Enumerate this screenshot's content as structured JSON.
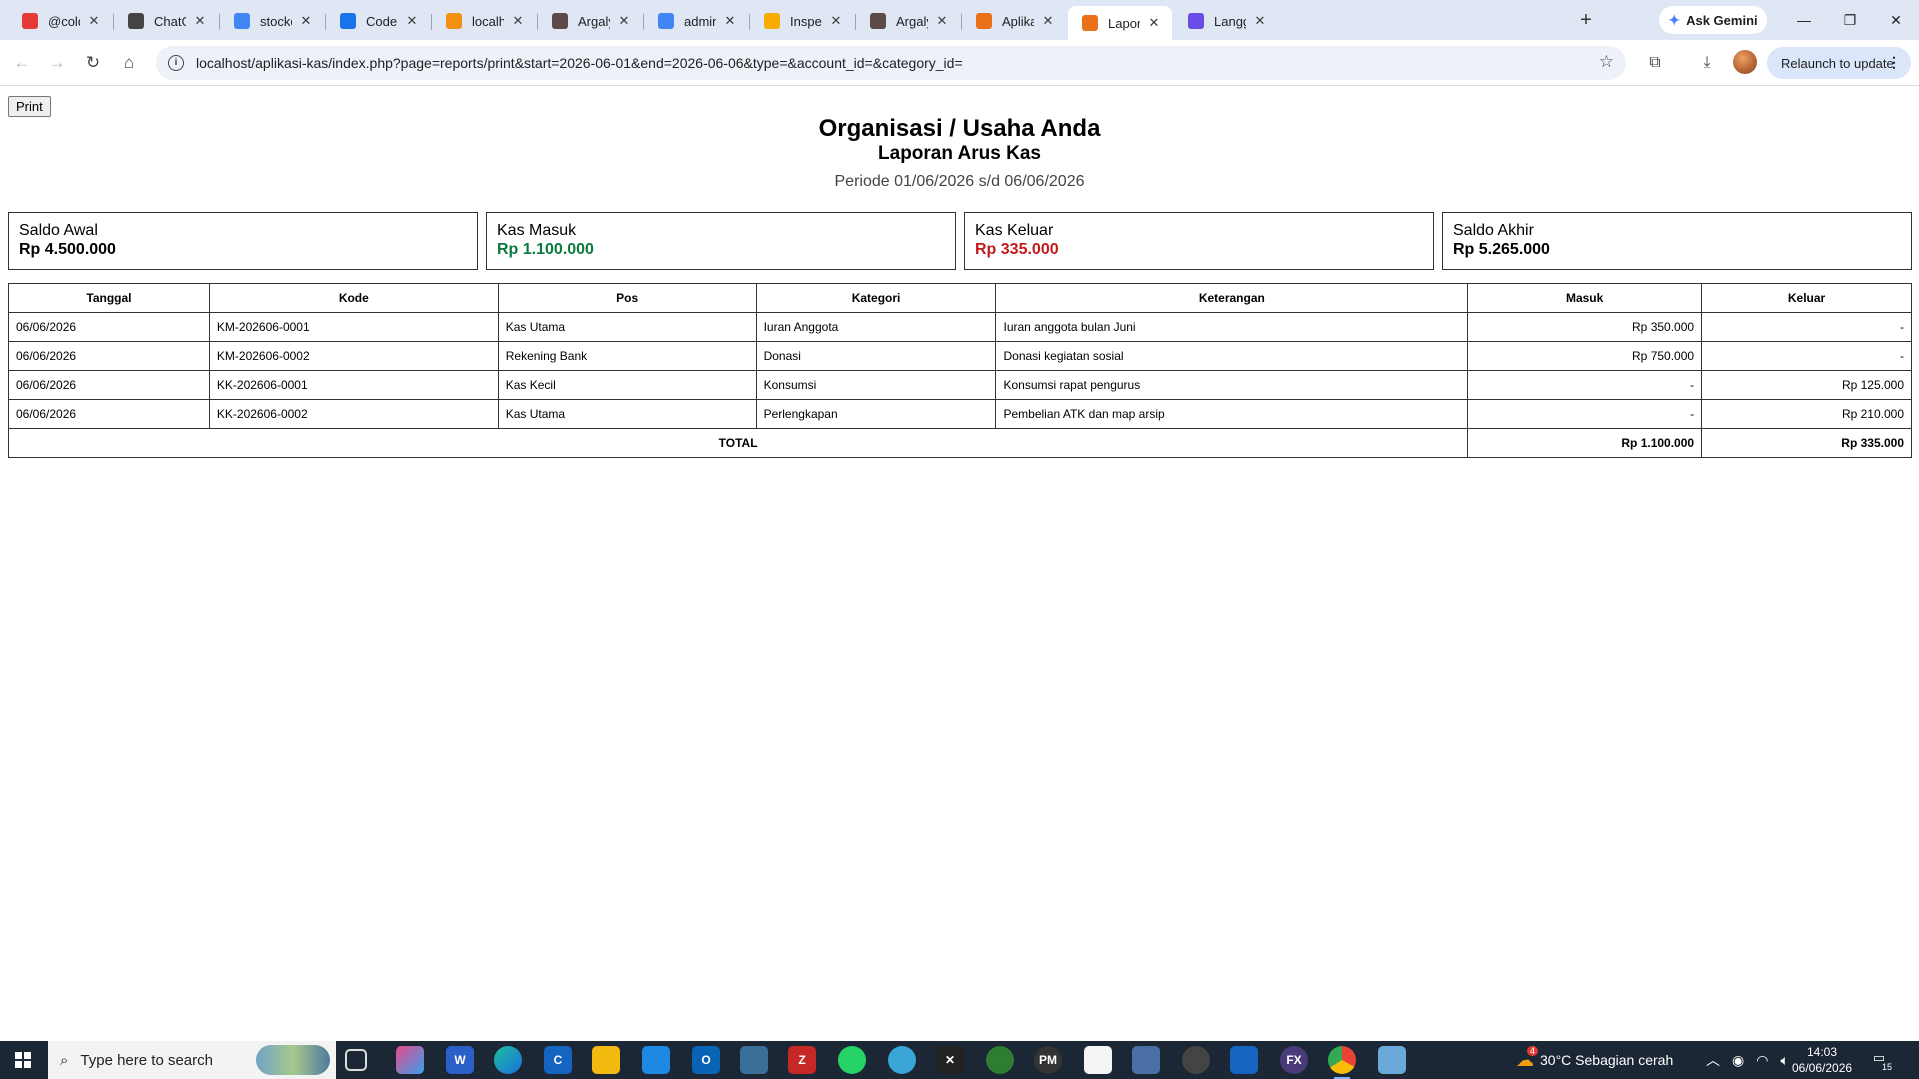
{
  "browser": {
    "tabs": [
      {
        "title": "@coldplay",
        "icon": "youtube-icon",
        "color": "#e53935"
      },
      {
        "title": "ChatGPT -",
        "icon": "chatgpt-icon",
        "color": "#444444"
      },
      {
        "title": "stockcodin",
        "icon": "google-icon",
        "color": "#4285f4"
      },
      {
        "title": "Codeignite",
        "icon": "code-icon",
        "color": "#1a73e8"
      },
      {
        "title": "localhost /",
        "icon": "phpmyadmin-icon",
        "color": "#f29111"
      },
      {
        "title": "Argalyta IT",
        "icon": "site-icon",
        "color": "#5b4a46"
      },
      {
        "title": "admin pan",
        "icon": "google-icon",
        "color": "#4285f4"
      },
      {
        "title": "Inspeksi U",
        "icon": "analytics-icon",
        "color": "#f9ab00"
      },
      {
        "title": "Argalyta IT",
        "icon": "site-icon",
        "color": "#5b4a46"
      },
      {
        "title": "Aplikasi Ka",
        "icon": "app-icon",
        "color": "#e8711a"
      },
      {
        "title": "Laporan Ka",
        "icon": "app-icon",
        "color": "#e8711a"
      },
      {
        "title": "Langganan",
        "icon": "lang-icon",
        "color": "#6b4de6"
      }
    ],
    "active_tab": 10,
    "ask_gemini": "Ask Gemini",
    "url": "localhost/aplikasi-kas/index.php?page=reports/print&start=2026-06-01&end=2026-06-06&type=&account_id=&category_id=",
    "relaunch": "Relaunch to update"
  },
  "page": {
    "print_label": "Print",
    "org_name": "Organisasi / Usaha Anda",
    "report_title": "Laporan Arus Kas",
    "period": "Periode 01/06/2026 s/d 06/06/2026"
  },
  "summary": {
    "saldo_awal": {
      "label": "Saldo Awal",
      "value": "Rp 4.500.000"
    },
    "kas_masuk": {
      "label": "Kas Masuk",
      "value": "Rp 1.100.000"
    },
    "kas_keluar": {
      "label": "Kas Keluar",
      "value": "Rp 335.000"
    },
    "saldo_akhir": {
      "label": "Saldo Akhir",
      "value": "Rp 5.265.000"
    }
  },
  "colors": {
    "in": "#0a7a3e",
    "out": "#c21b1b"
  },
  "table": {
    "headers": [
      "Tanggal",
      "Kode",
      "Pos",
      "Kategori",
      "Keterangan",
      "Masuk",
      "Keluar"
    ],
    "rows": [
      [
        "06/06/2026",
        "KM-202606-0001",
        "Kas Utama",
        "Iuran Anggota",
        "Iuran anggota bulan Juni",
        "Rp 350.000",
        "-"
      ],
      [
        "06/06/2026",
        "KM-202606-0002",
        "Rekening Bank",
        "Donasi",
        "Donasi kegiatan sosial",
        "Rp 750.000",
        "-"
      ],
      [
        "06/06/2026",
        "KK-202606-0001",
        "Kas Kecil",
        "Konsumsi",
        "Konsumsi rapat pengurus",
        "-",
        "Rp 125.000"
      ],
      [
        "06/06/2026",
        "KK-202606-0002",
        "Kas Utama",
        "Perlengkapan",
        "Pembelian ATK dan map arsip",
        "-",
        "Rp 210.000"
      ]
    ],
    "total": {
      "label": "TOTAL",
      "masuk": "Rp 1.100.000",
      "keluar": "Rp 335.000"
    }
  },
  "taskbar": {
    "search_placeholder": "Type here to search",
    "weather": "30°C  Sebagian cerah",
    "weather_badge": "4",
    "time": "14:03",
    "date": "06/06/2026",
    "notifications": "15"
  }
}
